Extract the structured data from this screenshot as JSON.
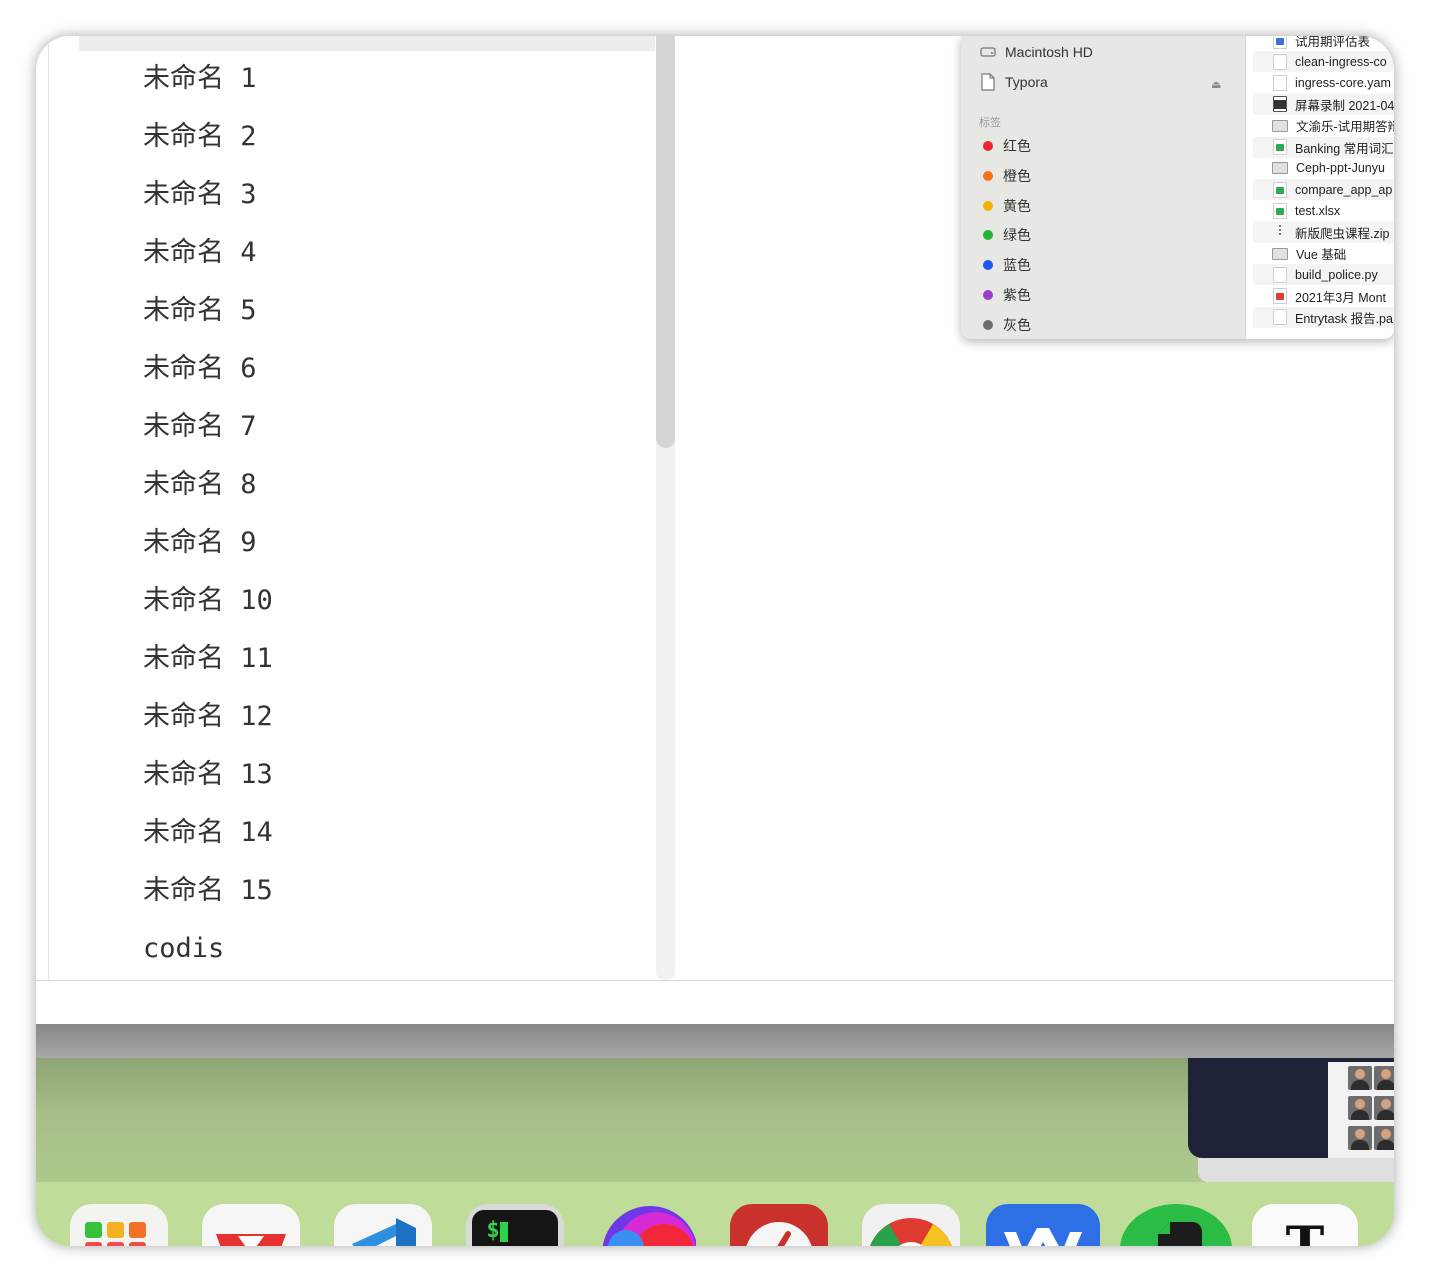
{
  "typora": {
    "files": [
      "未命名 1",
      "未命名 2",
      "未命名 3",
      "未命名 4",
      "未命名 5",
      "未命名 6",
      "未命名 7",
      "未命名 8",
      "未命名 9",
      "未命名 10",
      "未命名 11",
      "未命名 12",
      "未命名 13",
      "未命名 14",
      "未命名 15",
      "codis"
    ]
  },
  "finder": {
    "locations": [
      {
        "label": "Macintosh HD",
        "icon": "disk-icon"
      },
      {
        "label": "Typora",
        "icon": "document-icon"
      }
    ],
    "tags_header": "标签",
    "tags": [
      {
        "label": "红色",
        "color": "#f0262f"
      },
      {
        "label": "橙色",
        "color": "#f5711f"
      },
      {
        "label": "黄色",
        "color": "#f6b100"
      },
      {
        "label": "绿色",
        "color": "#22b532"
      },
      {
        "label": "蓝色",
        "color": "#1f58f0"
      },
      {
        "label": "紫色",
        "color": "#9f3bc8"
      },
      {
        "label": "灰色",
        "color": "#6e6e6e"
      }
    ],
    "files": [
      {
        "name": "试用期评估表",
        "icon": "doc"
      },
      {
        "name": "clean-ingress-co",
        "icon": "plain"
      },
      {
        "name": "ingress-core.yam",
        "icon": "plain"
      },
      {
        "name": "屏幕录制 2021-04",
        "icon": "vid"
      },
      {
        "name": "文渝乐-试用期答辩",
        "icon": "folder"
      },
      {
        "name": "Banking 常用词汇",
        "icon": "xls"
      },
      {
        "name": "Ceph-ppt-Junyu",
        "icon": "folder"
      },
      {
        "name": "compare_app_ap",
        "icon": "xls"
      },
      {
        "name": "test.xlsx",
        "icon": "xls"
      },
      {
        "name": "新版爬虫课程.zip",
        "icon": "zip"
      },
      {
        "name": "Vue 基础",
        "icon": "folder"
      },
      {
        "name": "build_police.py",
        "icon": "plain"
      },
      {
        "name": "2021年3月 Mont",
        "icon": "pdf"
      },
      {
        "name": "Entrytask 报告.pa",
        "icon": "plain"
      }
    ]
  },
  "dock": {
    "apps": [
      "launchpad",
      "wps",
      "vscode",
      "terminal",
      "firefox",
      "todo",
      "chrome",
      "word",
      "evernote",
      "typora"
    ],
    "terminal_prompt": "$",
    "typora_glyph": "T"
  }
}
